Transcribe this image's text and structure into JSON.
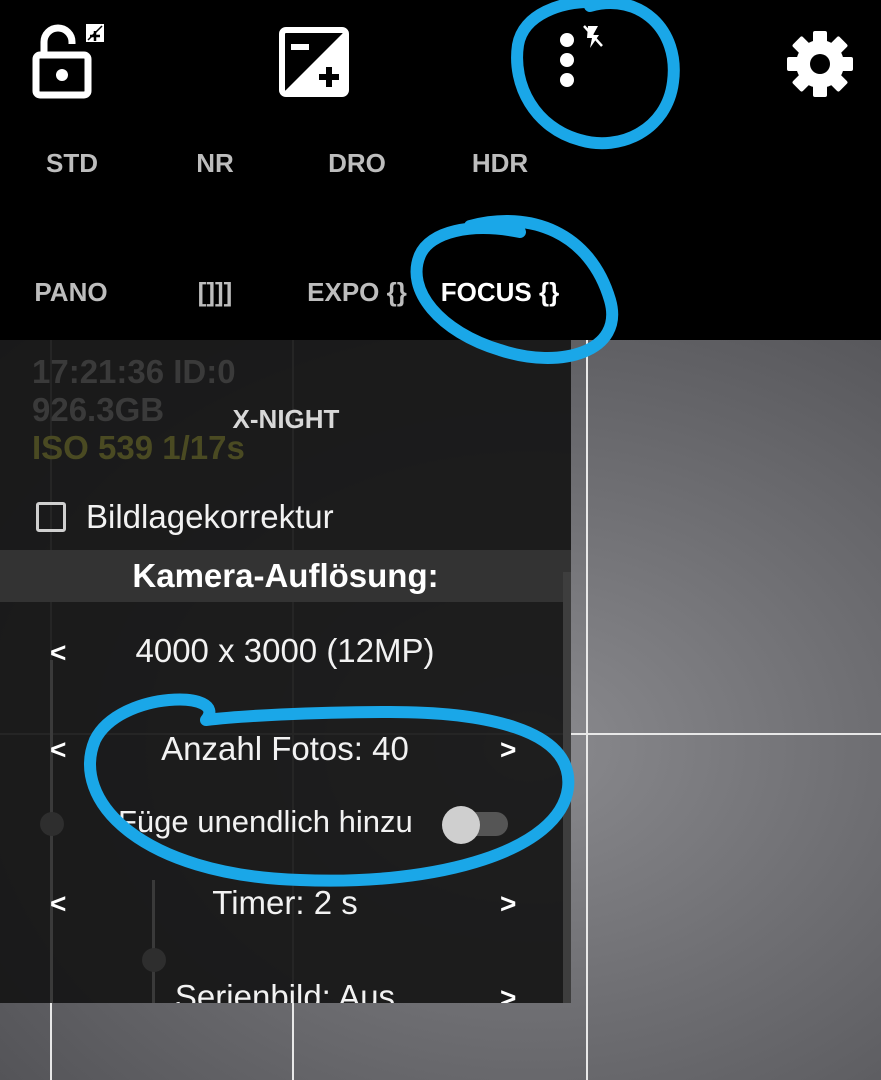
{
  "toolbar": {
    "lock_icon": "lock-open-icon",
    "exposure_icon": "exposure-plus-icon",
    "more_icon": "more-vert-flash-off-icon",
    "settings_icon": "gear-icon"
  },
  "modes_row1": [
    "STD",
    "NR",
    "DRO",
    "HDR"
  ],
  "modes_row2": [
    "PANO",
    "[]]]",
    "EXPO {}",
    "FOCUS {}"
  ],
  "active_mode": "FOCUS {}",
  "osd": {
    "time_id": "17:21:36  ID:0",
    "storage": "926.3GB",
    "exposure": "ISO 539  1/17s"
  },
  "panel": {
    "xnight_label": "X-NIGHT",
    "checkbox_label": "Bildlagekorrektur",
    "checkbox_checked": false,
    "section_title": "Kamera-Auflösung:",
    "resolution_value": "4000 x 3000 (12MP)",
    "photos_count": "Anzahl Fotos: 40",
    "infinite_label": "Füge unendlich hinzu",
    "infinite_enabled": false,
    "timer_value": "Timer: 2 s",
    "burst_value": "Serienbild: Aus",
    "prev_arrow": "<",
    "next_arrow": ">"
  },
  "colors": {
    "annotation": "#1aa7e8",
    "panel_bg": "#161616",
    "section_header_bg": "#333333",
    "active_mode": "#ffffff",
    "inactive_mode": "#bdbdbd",
    "osd_text": "#3a3a3a",
    "osd_iso": "#4a4a22"
  }
}
